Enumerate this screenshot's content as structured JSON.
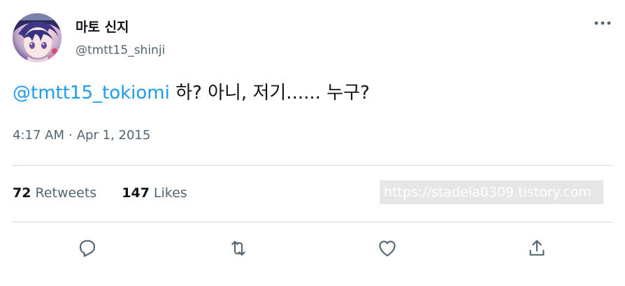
{
  "author": {
    "display_name": "마토 신지",
    "handle": "@tmtt15_shinji",
    "avatar": "anime-character-avatar"
  },
  "tweet": {
    "mention": "@tmtt15_tokiomi",
    "text": " 하? 아니, 저기...... 누구?"
  },
  "meta": {
    "time": "4:17 AM",
    "separator": "·",
    "date": "Apr 1, 2015"
  },
  "stats": {
    "retweets_count": "72",
    "retweets_label": "Retweets",
    "likes_count": "147",
    "likes_label": "Likes"
  },
  "watermark": "https://stadela0309.tistory.com",
  "icons": {
    "more": "more-icon",
    "reply": "reply-icon",
    "retweet": "retweet-icon",
    "like": "like-icon",
    "share": "share-icon"
  },
  "colors": {
    "text": "#0f1419",
    "secondary": "#536471",
    "mention": "#1d9bf0",
    "divider": "#cfd9de"
  }
}
